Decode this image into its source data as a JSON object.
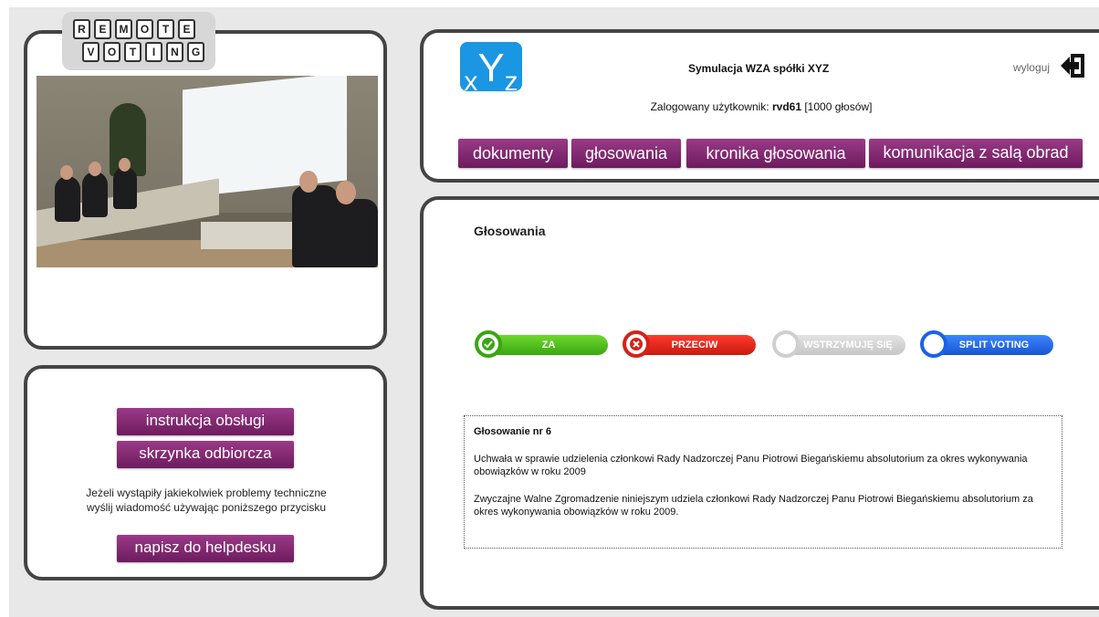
{
  "logo": {
    "row1": [
      "R",
      "E",
      "M",
      "O",
      "T",
      "E"
    ],
    "row2": [
      "V",
      "O",
      "T",
      "I",
      "N",
      "G"
    ]
  },
  "left_links": {
    "manual": "instrukcja obsługi",
    "inbox": "skrzynka odbiorcza",
    "help_text_1": "Jeżeli wystąpiły jakiekolwiek problemy techniczne",
    "help_text_2": "wyślij wiadomość używając poniższego przycisku",
    "helpdesk": "napisz do helpdesku"
  },
  "header": {
    "logo_x": "x",
    "logo_y": "Y",
    "logo_z": "z",
    "title": "Symulacja WZA spółki XYZ",
    "logout": "wyloguj",
    "user_prefix": "Zalogowany użytkownik: ",
    "user_name": "rvd61",
    "user_suffix": " [1000 głosów]"
  },
  "nav": {
    "documents": "dokumenty",
    "votes": "głosowania",
    "chronicle": "kronika głosowania",
    "communication": "komunikacja z salą obrad"
  },
  "main": {
    "title": "Głosowania",
    "vote_buttons": {
      "for": "ZA",
      "against": "PRZECIW",
      "abstain": "WSTRZYMUJĘ SIĘ",
      "split": "SPLIT VOTING"
    },
    "vote_colors": {
      "for": "#4fbf1f",
      "against": "#e0281c",
      "abstain": "#cfcfcf",
      "split": "#1b63e6"
    },
    "vote_title": "Głosowanie nr 6",
    "paragraph1": "Uchwała w sprawie udzielenia członkowi Rady Nadzorczej Panu Piotrowi Biegańskiemu absolutorium za okres wykonywania obowiązków w roku 2009",
    "paragraph2": "Zwyczajne Walne Zgromadzenie niniejszym udziela członkowi Rady Nadzorczej Panu Piotrowi Biegańskiemu absolutorium za okres wykonywania obowiązków w roku 2009."
  }
}
